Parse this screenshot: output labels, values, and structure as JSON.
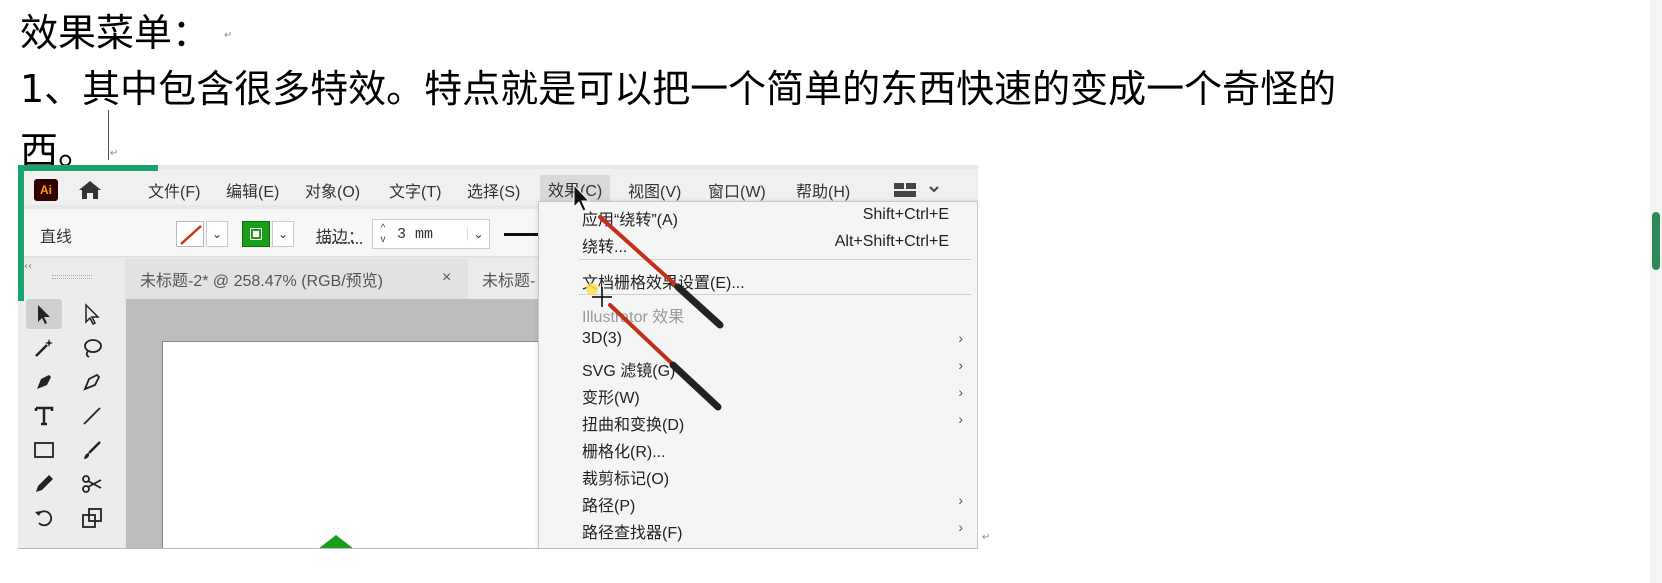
{
  "document": {
    "heading": "效果菜单：",
    "line2": "1、其中包含很多特效。特点就是可以把一个简单的东西快速的变成一个奇怪的",
    "line3": "西。",
    "para_mark": "↵"
  },
  "app": {
    "logo_text": "Ai",
    "menu": [
      {
        "label": "文件(F)"
      },
      {
        "label": "编辑(E)"
      },
      {
        "label": "对象(O)"
      },
      {
        "label": "文字(T)"
      },
      {
        "label": "选择(S)"
      },
      {
        "label": "效果(C)"
      },
      {
        "label": "视图(V)"
      },
      {
        "label": "窗口(W)"
      },
      {
        "label": "帮助(H)"
      }
    ],
    "active_menu": "效果(C)",
    "control_bar": {
      "selection_label": "直线",
      "stroke_label": "描边：",
      "stroke_value": "3 mm",
      "stroke_color": "#d03010",
      "fill_color": "#1a9e1a"
    },
    "tabs": [
      {
        "label": "未标题-2* @ 258.47% (RGB/预览)",
        "close": "×"
      },
      {
        "label": "未标题-"
      }
    ],
    "toolbar_header": "‹‹",
    "effect_menu": {
      "items": [
        {
          "label": "应用“绕转”(A)",
          "shortcut": "Shift+Ctrl+E"
        },
        {
          "label": "绕转...",
          "shortcut": "Alt+Shift+Ctrl+E"
        },
        {
          "label": "文档栅格效果设置(E)..."
        },
        {
          "label": "Illustrator 效果",
          "section": true
        },
        {
          "label": "3D(3)",
          "submenu": "›"
        },
        {
          "label": "SVG 滤镜(G)",
          "submenu": "›"
        },
        {
          "label": "变形(W)",
          "submenu": "›"
        },
        {
          "label": "扭曲和变换(D)",
          "submenu": "›"
        },
        {
          "label": "栅格化(R)..."
        },
        {
          "label": "裁剪标记(O)"
        },
        {
          "label": "路径(P)",
          "submenu": "›"
        },
        {
          "label": "路径查找器(F)",
          "submenu": "›"
        }
      ]
    }
  },
  "colors": {
    "accent_green": "#1aa36f",
    "annotation_red": "#c0301a"
  }
}
